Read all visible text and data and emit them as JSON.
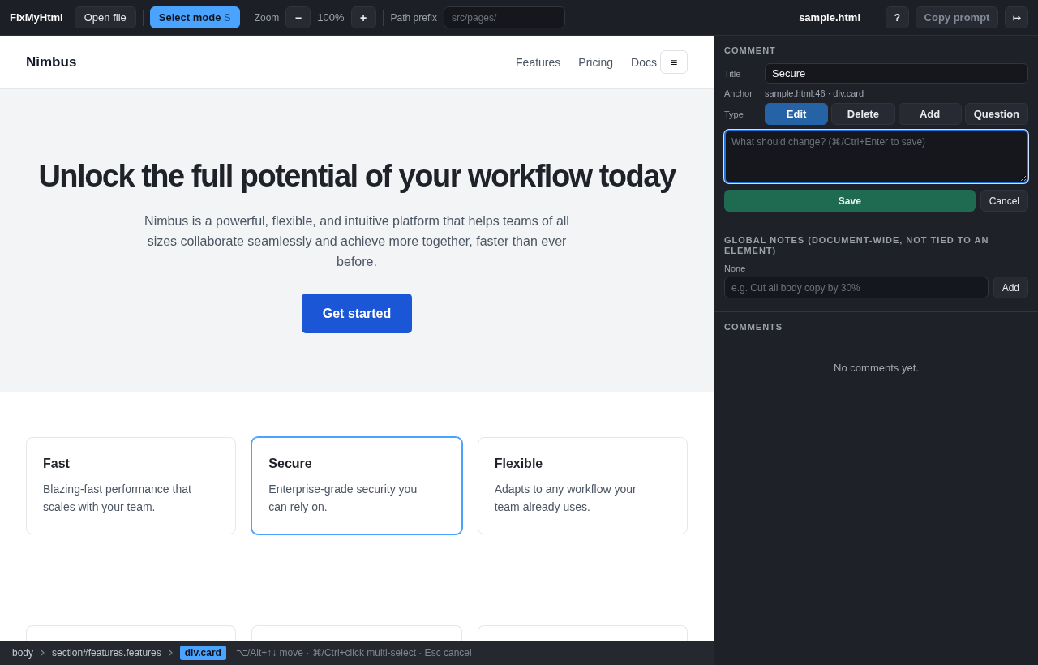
{
  "toolbar": {
    "app_name": "FixMyHtml",
    "open_button": "Open file",
    "select_mode": {
      "label": "Select mode",
      "shortcut": "S",
      "on": true
    },
    "zoom": {
      "label": "Zoom",
      "decrease": "−",
      "value": "100%",
      "increase": "+"
    },
    "path_prefix": {
      "label": "Path prefix",
      "placeholder": "src/pages/"
    },
    "file_name": "sample.html",
    "help_button": "?",
    "copy_prompt": {
      "label": "Copy prompt",
      "disabled": true
    },
    "collapse_button": "↦"
  },
  "preview": {
    "nav": {
      "brand": "Nimbus",
      "links": [
        "Features",
        "Pricing",
        "Docs"
      ],
      "menu_button": "≡"
    },
    "hero": {
      "heading": "Unlock the full potential of your workflow today",
      "text": "Nimbus is a powerful, flexible, and intuitive platform that helps teams of all sizes collaborate seamlessly and achieve more together, faster than ever before.",
      "cta": "Get started"
    },
    "features": [
      {
        "title": "Fast",
        "text": "Blazing-fast performance that scales with your team.",
        "selected": false
      },
      {
        "title": "Secure",
        "text": "Enterprise-grade security you can rely on.",
        "selected": true
      },
      {
        "title": "Flexible",
        "text": "Adapts to any workflow your team already uses.",
        "selected": false
      }
    ],
    "more_features": [
      {
        "selected": false
      },
      {
        "selected": false
      },
      {
        "selected": false
      }
    ]
  },
  "status_bar": {
    "breadcrumbs": [
      {
        "label": "body",
        "selected": false
      },
      {
        "label": "section#features.features",
        "selected": false
      },
      {
        "label": "div.card",
        "selected": true
      }
    ],
    "hint": "⌥/Alt+↑↓ move · ⌘/Ctrl+click multi-select · Esc cancel"
  },
  "sidebar": {
    "comment": {
      "heading": "COMMENT",
      "title": {
        "label": "Title",
        "value": "Secure"
      },
      "anchor": {
        "label": "Anchor",
        "value": "sample.html:46 · div.card"
      },
      "type": {
        "label": "Type",
        "options": [
          {
            "label": "Edit",
            "selected": true
          },
          {
            "label": "Delete",
            "selected": false
          },
          {
            "label": "Add",
            "selected": false
          },
          {
            "label": "Question",
            "selected": false
          }
        ]
      },
      "note": {
        "placeholder": "What should change? (⌘/Ctrl+Enter to save)",
        "focused": true
      },
      "save_button": "Save",
      "cancel_button": "Cancel"
    },
    "global_notes": {
      "heading": "GLOBAL NOTES (DOCUMENT-WIDE, NOT TIED TO AN ELEMENT)",
      "empty_text": "None",
      "input": {
        "placeholder": "e.g. Cut all body copy by 30%"
      },
      "add_button": "Add"
    },
    "comments": {
      "heading": "COMMENTS",
      "empty_text": "No comments yet."
    }
  }
}
